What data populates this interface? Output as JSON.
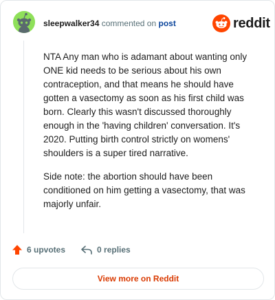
{
  "comment": {
    "username": "sleepwalker34",
    "commented_on_text": "commented on",
    "post_link": "post",
    "paragraphs": [
      "NTA Any man who is adamant about wanting only ONE kid needs to be serious about his own contraception, and that means he should have gotten a vasectomy as soon as his first child was born. Clearly this wasn't discussed thoroughly enough in the 'having children' conversation. It's 2020. Putting birth control strictly on womens' shoulders is a super tired narrative.",
      "Side note: the abortion should have been conditioned on him getting a vasectomy, that was majorly unfair."
    ]
  },
  "brand": {
    "wordmark": "reddit",
    "logo_icon": "reddit-alien-icon",
    "color": "#ff4500"
  },
  "actions": {
    "upvotes_label": "6 upvotes",
    "replies_label": "0 replies",
    "upvote_icon": "upvote-arrow-icon",
    "reply_icon": "reply-arrow-icon",
    "upvote_color": "#ff4500"
  },
  "footer": {
    "view_more_label": "View more on Reddit",
    "accent": "#d93900"
  },
  "avatar": {
    "icon": "snoo-avatar-icon",
    "background": "#8fe05a"
  }
}
